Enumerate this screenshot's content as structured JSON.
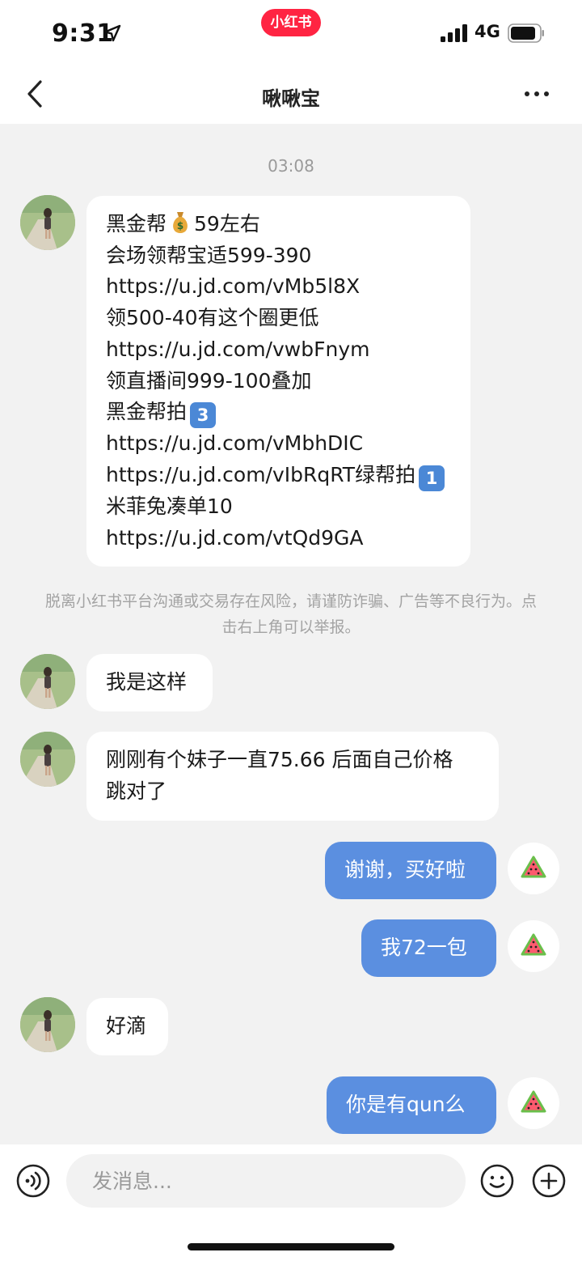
{
  "status_bar": {
    "time": "9:31",
    "app_badge": "小红书",
    "network": "4G"
  },
  "nav": {
    "title": "啾啾宝"
  },
  "chat": {
    "timestamp": "03:08",
    "messages": [
      {
        "from": "other",
        "lines": [
          "黑金帮",
          "59左右",
          "会场领帮宝适599-390",
          "https://u.jd.com/vMb5l8X",
          "领500-40有这个圈更低",
          "https://u.jd.com/vwbFnym",
          "领直播间999-100叠加",
          "黑金帮拍",
          "3",
          "https://u.jd.com/vMbhDIC",
          "https://u.jd.com/vIbRqRT绿帮拍",
          "1",
          "米菲兔凑单10",
          "https://u.jd.com/vtQd9GA"
        ]
      },
      {
        "from": "other",
        "lines": [
          "我是这样"
        ]
      },
      {
        "from": "other",
        "lines": [
          "刚刚有个妹子一直75.66 后面自己价格",
          "跳对了"
        ]
      },
      {
        "from": "self",
        "lines": [
          "谢谢，买好啦"
        ]
      },
      {
        "from": "self",
        "lines": [
          "我72一包"
        ]
      },
      {
        "from": "other",
        "lines": [
          "好滴"
        ]
      },
      {
        "from": "self",
        "lines": [
          "你是有qun么"
        ]
      }
    ],
    "warning": "脱离小红书平台沟通或交易存在风险，请谨防诈骗、广告等不良行为。点击右上角可以举报。"
  },
  "input_bar": {
    "placeholder": "发消息..."
  },
  "colors": {
    "brand": "#ff2442",
    "outgoing_bubble": "#5b8fe0",
    "background": "#f2f2f2"
  },
  "icons": [
    "back-icon",
    "more-icon",
    "voice-icon",
    "emoji-icon",
    "add-icon",
    "watermelon-icon",
    "money-bag-icon"
  ]
}
